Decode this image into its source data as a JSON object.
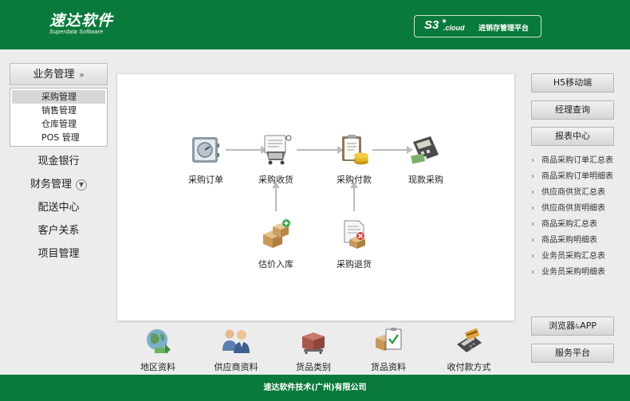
{
  "header": {
    "logo_main": "速达软件",
    "logo_sub": "Superdata Software",
    "brand_s3": "S3",
    "brand_cloud": ".cloud",
    "brand_name": "进销存管理平台",
    "bg_color": "#0a7a3c"
  },
  "left_nav": {
    "current_label": "业务管理",
    "current_icon": "double-chevron-down-icon",
    "submenu": [
      "采购管理",
      "销售管理",
      "仓库管理",
      "POS 管理"
    ],
    "items": [
      "现金银行",
      "财务管理",
      "配送中心",
      "客户关系",
      "项目管理"
    ]
  },
  "flow": {
    "nodes": [
      {
        "label": "采购订单",
        "icon": "safe-icon"
      },
      {
        "label": "采购收货",
        "icon": "cart-icon"
      },
      {
        "label": "采购付款",
        "icon": "coins-clipboard-icon"
      },
      {
        "label": "现款采购",
        "icon": "calculator-icon"
      },
      {
        "label": "估价入库",
        "icon": "boxes-icon"
      },
      {
        "label": "采购退货",
        "icon": "return-doc-icon"
      }
    ]
  },
  "bottom_tools": [
    {
      "label": "地区资料",
      "icon": "region-icon"
    },
    {
      "label": "供应商资料",
      "icon": "suppliers-icon"
    },
    {
      "label": "货品类别",
      "icon": "goods-category-icon"
    },
    {
      "label": "货品资料",
      "icon": "goods-info-icon"
    },
    {
      "label": "收付款方式",
      "icon": "payment-icon"
    }
  ],
  "right_panel": {
    "mobile": "H5移动端",
    "manager": "经理查询",
    "reports_header": "报表中心",
    "reports": [
      "商品采购订单汇总表",
      "商品采购订单明细表",
      "供应商供货汇总表",
      "供应商供货明细表",
      "商品采购汇总表",
      "商品采购明细表",
      "业务员采购汇总表",
      "业务员采购明细表"
    ],
    "browser_a": "浏览器",
    "browser_amp": "&",
    "browser_b": "APP",
    "service": "服务平台"
  },
  "footer": {
    "text": "速达软件技术(广州)有限公司"
  }
}
